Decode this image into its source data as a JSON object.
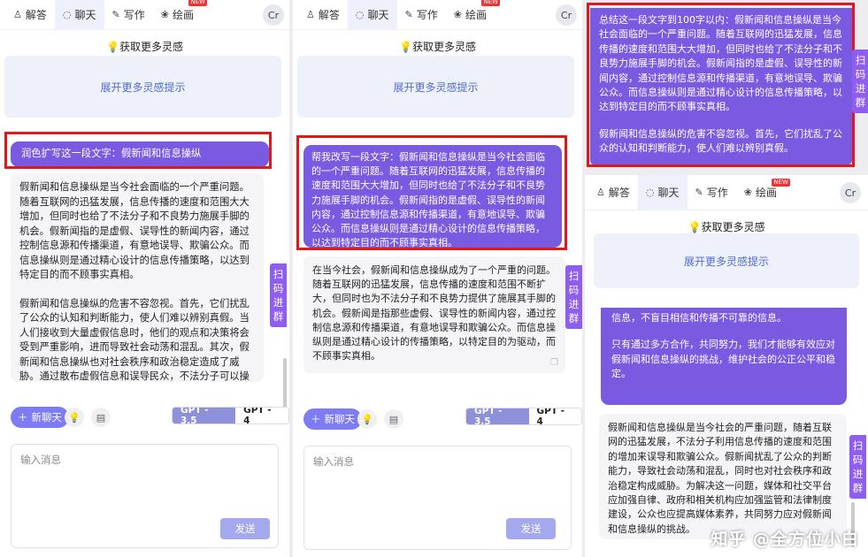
{
  "nav": {
    "tabs": [
      {
        "icon": "answer-icon",
        "glyph": "♙",
        "label": "解答"
      },
      {
        "icon": "chat-icon",
        "glyph": "◌",
        "label": "聊天"
      },
      {
        "icon": "write-icon",
        "glyph": "✎",
        "label": "写作"
      },
      {
        "icon": "paint-icon",
        "glyph": "❀",
        "label": "绘画"
      }
    ],
    "new_badge": "NEW",
    "avatar": "Cr"
  },
  "inspiration": "获取更多灵感",
  "expand_tips": "展开更多灵感提示",
  "qr_group": "扫\n码\n进\n群",
  "new_chat": "新聊天",
  "models": {
    "gpt35": "GPT - 3.5",
    "gpt4": "GPT - 4"
  },
  "input_placeholder": "输入消息",
  "send": "发送",
  "panel1": {
    "user_msg": "润色扩写这一段文字：假新闻和信息操纵",
    "answer_p1": "假新闻和信息操纵是当今社会面临的一个严重问题。随着互联网的迅猛发展，信息传播的速度和范围大大增加，但同时也给了不法分子和不良势力施展手脚的机会。假新闻指的是虚假、误导性的新闻内容，通过控制信息源和传播渠道，有意地误导、欺骗公众。而信息操纵则是通过精心设计的信息传播策略，以达到特定目的而不顾事实真相。",
    "answer_p2": "假新闻和信息操纵的危害不容忽视。首先，它们扰乱了公众的认知和判断能力，使人们难以辨别真假。当人们接收到大量虚假信息时，他们的观点和决策将会受到严重影响，进而导致社会动荡和混乱。其次，假新闻和信息操纵也对社会秩序和政治稳定造成了威胁。通过散布虚假信息和误导民众，不法分子可以操纵公众舆论，干扰选举和政治进程，甚至煽动仇恨和暴力事件。"
  },
  "panel2": {
    "user_msg": "帮我改写一段文字：假新闻和信息操纵是当今社会面临的一个严重问题。随着互联网的迅猛发展，信息传播的速度和范围大大增加，但同时也给了不法分子和不良势力施展手脚的机会。假新闻指的是虚假、误导性的新闻内容，通过控制信息源和传播渠道，有意地误导、欺骗公众。而信息操纵则是通过精心设计的信息传播策略，以达到特定目的而不顾事实真相。",
    "answer": "在当今社会，假新闻和信息操纵成为了一个严重的问题。随着互联网的迅猛发展，信息传播的速度和范围不断扩大，但同时也为不法分子和不良势力提供了施展其手脚的机会。假新闻是指那些虚假、误导性的新闻内容，通过控制信息源和传播渠道，有意地误导和欺骗公众。而信息操纵则是通过精心设计的传播策略，以特定目的为驱动，而不顾事实真相。"
  },
  "panel3": {
    "user_msg_p1": "总结这一段文字到100字以内：假新闻和信息操纵是当今社会面临的一个严重问题。随着互联网的迅猛发展，信息传播的速度和范围大大增加，但同时也给了不法分子和不良势力施展手脚的机会。假新闻指的是虚假、误导性的新闻内容，通过控制信息源和传播渠道，有意地误导、欺骗公众。而信息操纵则是通过精心设计的信息传播策略，以达到特定目的而不顾事实真相。",
    "user_msg_p2": "假新闻和信息操纵的危害不容忽视。首先，它们扰乱了公众的认知和判断能力，使人们难以辨别真假。",
    "user_msg_tail_a": "信息，不盲目相信和传播不可靠的信息。",
    "user_msg_tail_b": "只有通过多方合作，共同努力，我们才能够有效应对假新闻和信息操纵的挑战，维护社会的公正公平和稳定。",
    "answer": "假新闻和信息操纵是当今社会的严重问题，随着互联网的迅猛发展，不法分子利用信息传播的速度和范围的增加来误导和欺骗公众。假新闻扰乱了公众的判断能力，导致社会动荡和混乱，同时也对社会秩序和政治稳定构成威胁。为解决这一问题，媒体和社交平台应加强自律、政府和相关机构应加强监管和法律制度建设，公众也应提高媒体素养，共同努力应对假新闻和信息操纵的挑战。"
  },
  "watermark": "知乎 @全方位小白"
}
